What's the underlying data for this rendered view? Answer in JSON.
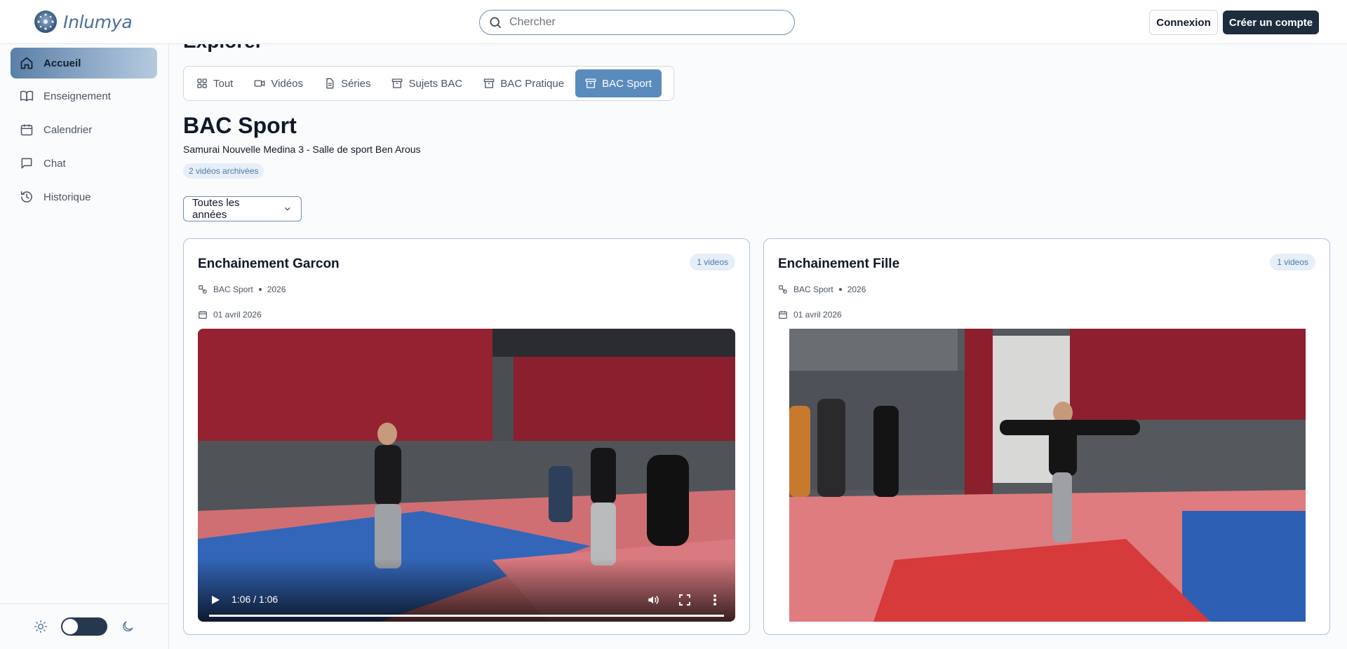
{
  "app": {
    "name": "Inlumya"
  },
  "header": {
    "search_placeholder": "Chercher",
    "login_label": "Connexion",
    "signup_label": "Créer un compte"
  },
  "sidebar": {
    "items": [
      {
        "label": "Accueil",
        "icon": "home-icon",
        "active": true
      },
      {
        "label": "Enseignement",
        "icon": "book-icon",
        "active": false
      },
      {
        "label": "Calendrier",
        "icon": "calendar-icon",
        "active": false
      },
      {
        "label": "Chat",
        "icon": "chat-icon",
        "active": false
      },
      {
        "label": "Historique",
        "icon": "history-icon",
        "active": false
      }
    ],
    "theme_toggle": {
      "mode": "light"
    }
  },
  "main": {
    "page_title": "Explorer",
    "tabs": [
      {
        "label": "Tout",
        "icon": "grid-icon",
        "active": false
      },
      {
        "label": "Vidéos",
        "icon": "video-icon",
        "active": false
      },
      {
        "label": "Séries",
        "icon": "document-icon",
        "active": false
      },
      {
        "label": "Sujets BAC",
        "icon": "archive-icon",
        "active": false
      },
      {
        "label": "BAC Pratique",
        "icon": "archive-icon",
        "active": false
      },
      {
        "label": "BAC Sport",
        "icon": "archive-icon",
        "active": true
      }
    ],
    "section_title": "BAC Sport",
    "section_subtitle": "Samurai Nouvelle Medina 3 - Salle de sport Ben Arous",
    "archived_badge": "2 vidéos archivées",
    "year_filter": "Toutes les années",
    "cards": [
      {
        "title": "Enchainement Garcon",
        "badge": "1 videos",
        "category": "BAC Sport",
        "year": "2026",
        "date": "01 avril 2026",
        "video": {
          "time": "1:06 / 1:06",
          "progress": 1.0,
          "controls_visible": true
        }
      },
      {
        "title": "Enchainement Fille",
        "badge": "1 videos",
        "category": "BAC Sport",
        "year": "2026",
        "date": "01 avril 2026",
        "video": {
          "time": "",
          "progress": 0,
          "controls_visible": false
        }
      }
    ]
  },
  "colors": {
    "accent": "#5a8bbd",
    "brand_dark": "#1e2d3d",
    "badge_bg": "#e7eef7",
    "badge_text": "#4a7aa8"
  }
}
